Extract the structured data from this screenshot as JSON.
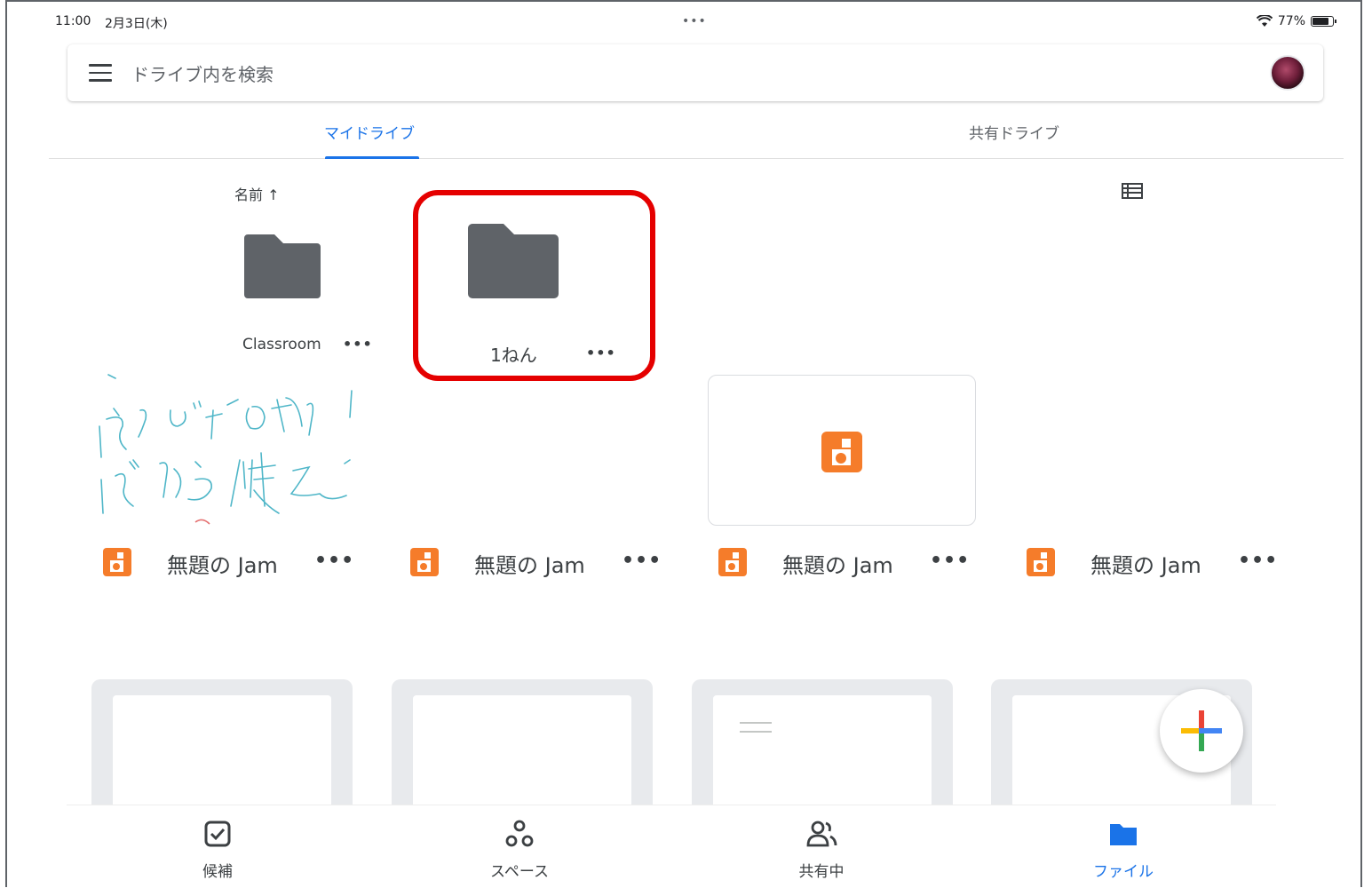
{
  "status_bar": {
    "time": "11:00",
    "date": "2月3日(木)",
    "dots": "•••",
    "battery": "77%"
  },
  "search": {
    "placeholder": "ドライブ内を検索"
  },
  "tabs": [
    {
      "label": "マイドライブ",
      "active": true
    },
    {
      "label": "共有ドライブ",
      "active": false
    }
  ],
  "sort": {
    "label": "名前 ↑"
  },
  "folders": [
    {
      "name": "Classroom",
      "more": "•••"
    },
    {
      "name": "1ねん",
      "more": "•••",
      "highlighted": true
    }
  ],
  "jam_files": [
    {
      "name": "無題の Jam",
      "more": "•••"
    },
    {
      "name": "無題の Jam",
      "more": "•••"
    },
    {
      "name": "無題の Jam",
      "more": "•••"
    },
    {
      "name": "無題の Jam",
      "more": "•••"
    }
  ],
  "bottom_nav": [
    {
      "label": "候補",
      "icon": "check-box-icon",
      "active": false
    },
    {
      "label": "スペース",
      "icon": "spaces-icon",
      "active": false
    },
    {
      "label": "共有中",
      "icon": "people-icon",
      "active": false
    },
    {
      "label": "ファイル",
      "icon": "folder-icon",
      "active": true
    }
  ],
  "colors": {
    "accent": "#1a73e8",
    "folder": "#5f6368",
    "jam": "#f57c2a",
    "highlight": "#e50000"
  }
}
